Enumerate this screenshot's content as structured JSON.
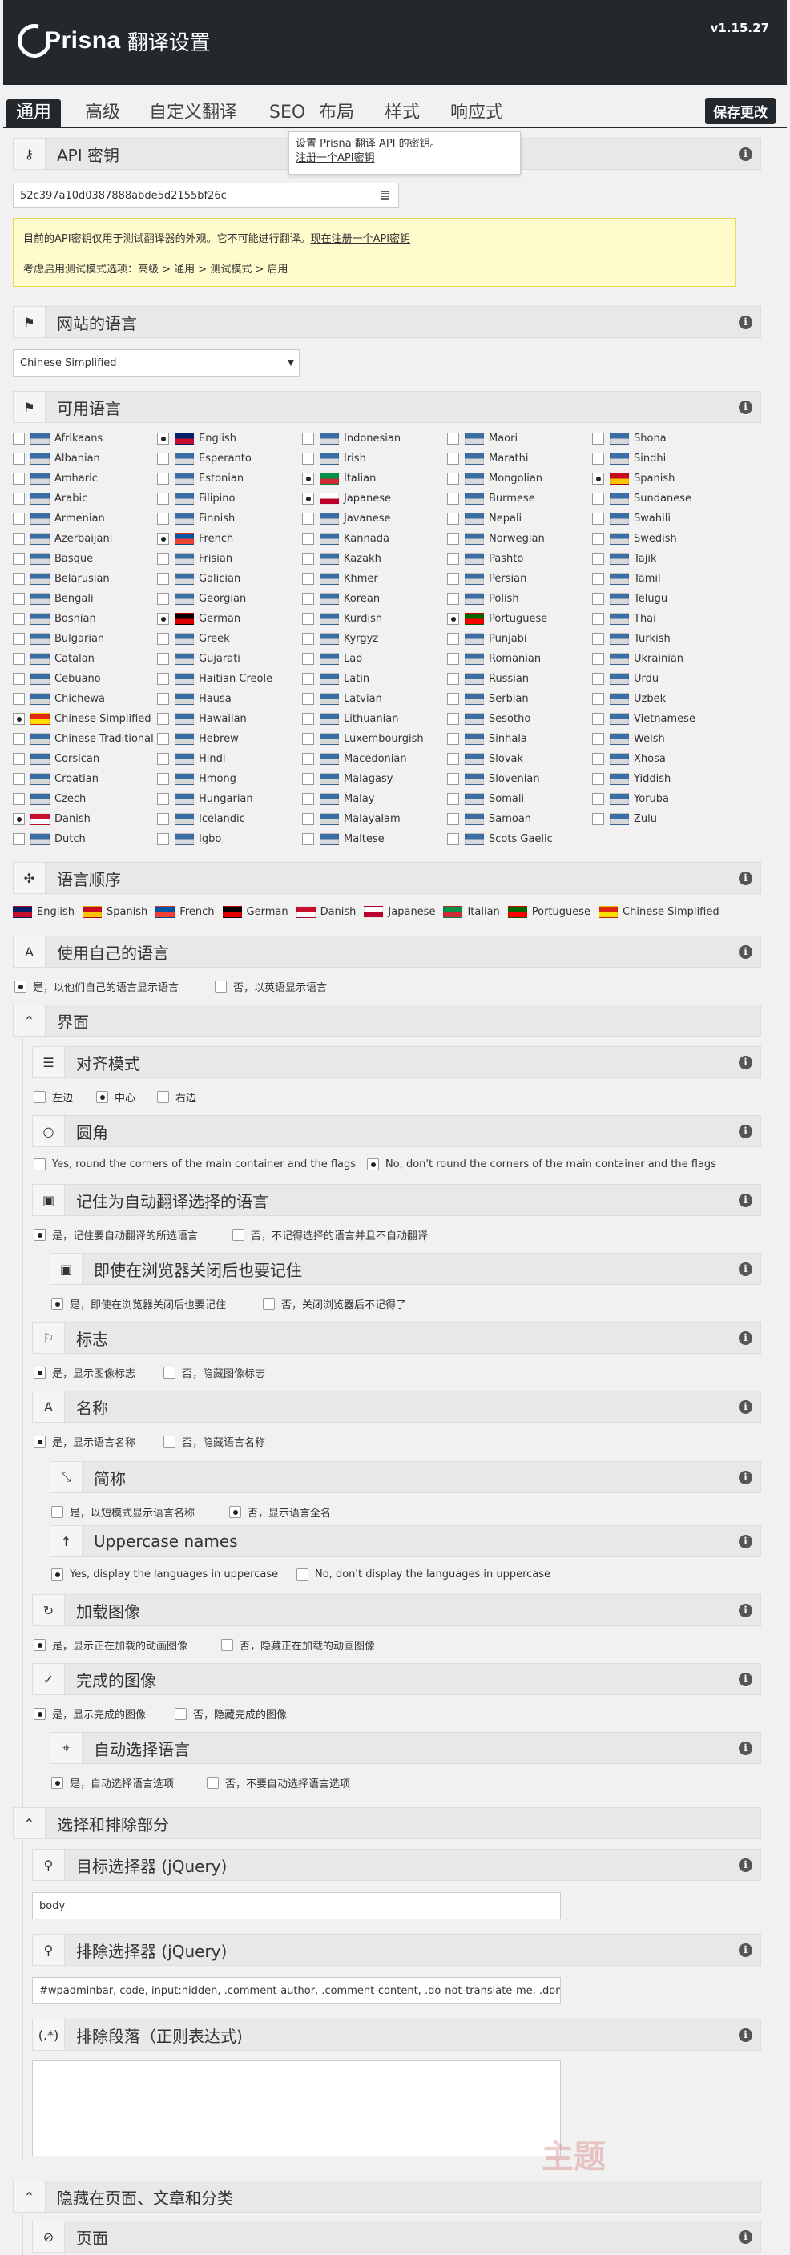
{
  "header": {
    "brand": "Prisna",
    "title": "翻译设置",
    "version": "v1.15.27"
  },
  "tabs": [
    "通用",
    "高级",
    "自定义翻译",
    "SEO",
    "布局",
    "样式",
    "响应式"
  ],
  "save_label": "保存更改",
  "api": {
    "title": "API 密钥",
    "key": "52c397a10d0387888abde5d2155bf26c",
    "tip_line1": "设置 Prisna 翻译 API 的密钥。",
    "tip_link": "注册一个API密钥",
    "warn_line1": "目前的API密钥仅用于测试翻译器的外观。它不可能进行翻译。",
    "warn_link": "现在注册一个API密钥",
    "warn_line2": "考虑启用测试模式选项：高级 > 通用 > 测试模式 > 启用"
  },
  "site_lang": {
    "title": "网站的语言",
    "value": "Chinese Simplified"
  },
  "avail": {
    "title": "可用语言"
  },
  "languages": [
    [
      "Afrikaans",
      "English",
      "Indonesian",
      "Maori",
      "Shona"
    ],
    [
      "Albanian",
      "Esperanto",
      "Irish",
      "Marathi",
      "Sindhi"
    ],
    [
      "Amharic",
      "Estonian",
      "Italian",
      "Mongolian",
      "Spanish"
    ],
    [
      "Arabic",
      "Filipino",
      "Japanese",
      "Burmese",
      "Sundanese"
    ],
    [
      "Armenian",
      "Finnish",
      "Javanese",
      "Nepali",
      "Swahili"
    ],
    [
      "Azerbaijani",
      "French",
      "Kannada",
      "Norwegian",
      "Swedish"
    ],
    [
      "Basque",
      "Frisian",
      "Kazakh",
      "Pashto",
      "Tajik"
    ],
    [
      "Belarusian",
      "Galician",
      "Khmer",
      "Persian",
      "Tamil"
    ],
    [
      "Bengali",
      "Georgian",
      "Korean",
      "Polish",
      "Telugu"
    ],
    [
      "Bosnian",
      "German",
      "Kurdish",
      "Portuguese",
      "Thai"
    ],
    [
      "Bulgarian",
      "Greek",
      "Kyrgyz",
      "Punjabi",
      "Turkish"
    ],
    [
      "Catalan",
      "Gujarati",
      "Lao",
      "Romanian",
      "Ukrainian"
    ],
    [
      "Cebuano",
      "Haitian Creole",
      "Latin",
      "Russian",
      "Urdu"
    ],
    [
      "Chichewa",
      "Hausa",
      "Latvian",
      "Serbian",
      "Uzbek"
    ],
    [
      "Chinese Simplified",
      "Hawaiian",
      "Lithuanian",
      "Sesotho",
      "Vietnamese"
    ],
    [
      "Chinese Traditional",
      "Hebrew",
      "Luxembourgish",
      "Sinhala",
      "Welsh"
    ],
    [
      "Corsican",
      "Hindi",
      "Macedonian",
      "Slovak",
      "Xhosa"
    ],
    [
      "Croatian",
      "Hmong",
      "Malagasy",
      "Slovenian",
      "Yiddish"
    ],
    [
      "Czech",
      "Hungarian",
      "Malay",
      "Somali",
      "Yoruba"
    ],
    [
      "Danish",
      "Icelandic",
      "Malayalam",
      "Samoan",
      "Zulu"
    ],
    [
      "Dutch",
      "Igbo",
      "Maltese",
      "Scots Gaelic",
      ""
    ]
  ],
  "selected_langs": [
    "English",
    "Italian",
    "Spanish",
    "Japanese",
    "French",
    "German",
    "Portuguese",
    "Chinese Simplified",
    "Danish"
  ],
  "order": {
    "title": "语言顺序",
    "items": [
      "English",
      "Spanish",
      "French",
      "German",
      "Danish",
      "Japanese",
      "Italian",
      "Portuguese",
      "Chinese Simplified"
    ]
  },
  "own": {
    "title": "使用自己的语言",
    "yes": "是，以他们自己的语言显示语言",
    "no": "否，以英语显示语言"
  },
  "iface": {
    "title": "界面"
  },
  "align": {
    "title": "对齐模式",
    "left": "左边",
    "center": "中心",
    "right": "右边"
  },
  "round": {
    "title": "圆角",
    "yes": "Yes, round the corners of the main container and the flags",
    "no": "No, don't round the corners of the main container and the flags"
  },
  "remember": {
    "title": "记住为自动翻译选择的语言",
    "yes": "是，记住要自动翻译的所选语言",
    "no": "否，不记得选择的语言并且不自动翻译"
  },
  "persist": {
    "title": "即使在浏览器关闭后也要记住",
    "yes": "是，即使在浏览器关闭后也要记住",
    "no": "否，关闭浏览器后不记得了"
  },
  "flags": {
    "title": "标志",
    "yes": "是，显示图像标志",
    "no": "否，隐藏图像标志"
  },
  "names": {
    "title": "名称",
    "yes": "是，显示语言名称",
    "no": "否，隐藏语言名称"
  },
  "short": {
    "title": "简称",
    "yes": "是，以短模式显示语言名称",
    "no": "否，显示语言全名"
  },
  "upper": {
    "title": "Uppercase names",
    "yes": "Yes, display the languages in uppercase",
    "no": "No, don't display the languages in uppercase"
  },
  "loading": {
    "title": "加载图像",
    "yes": "是，显示正在加载的动画图像",
    "no": "否，隐藏正在加载的动画图像"
  },
  "done": {
    "title": "完成的图像",
    "yes": "是，显示完成的图像",
    "no": "否，隐藏完成的图像"
  },
  "auto": {
    "title": "自动选择语言",
    "yes": "是，自动选择语言选项",
    "no": "否，不要自动选择语言选项"
  },
  "sel": {
    "title": "选择和排除部分"
  },
  "target": {
    "title": "目标选择器 (jQuery)",
    "value": "body"
  },
  "exclude": {
    "title": "排除选择器 (jQuery)",
    "value": "#wpadminbar, code, input:hidden, .comment-author, .comment-content, .do-not-translate-me, .dont-tra"
  },
  "para": {
    "title": "排除段落（正则表达式)"
  },
  "hide": {
    "title": "隐藏在页面、文章和分类"
  },
  "page": {
    "title": "页面"
  },
  "watermark": "主题"
}
